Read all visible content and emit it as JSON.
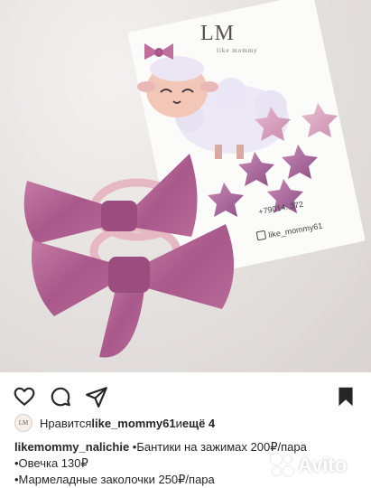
{
  "post": {
    "photo": {
      "card_logo": "LM",
      "card_subtitle": "like mommy",
      "card_phone": "+79014..372",
      "card_handle": "like_mommy61"
    },
    "actions": {
      "like_icon": "heart-icon",
      "comment_icon": "comment-icon",
      "share_icon": "paper-plane-icon",
      "save_icon": "bookmark-icon"
    },
    "likes": {
      "avatar_text": "LM",
      "prefix": "Нравится ",
      "user": "like_mommy61",
      "middle": " и ",
      "more": "ещё 4"
    },
    "caption": {
      "username": "likemommy_nalichie",
      "line1": " •Бантики на зажимах 200₽/пара",
      "line2": "•Овечка 130₽",
      "line3": "•Мармеладные заколочки 250₽/пара"
    },
    "watermark": "Avito"
  }
}
